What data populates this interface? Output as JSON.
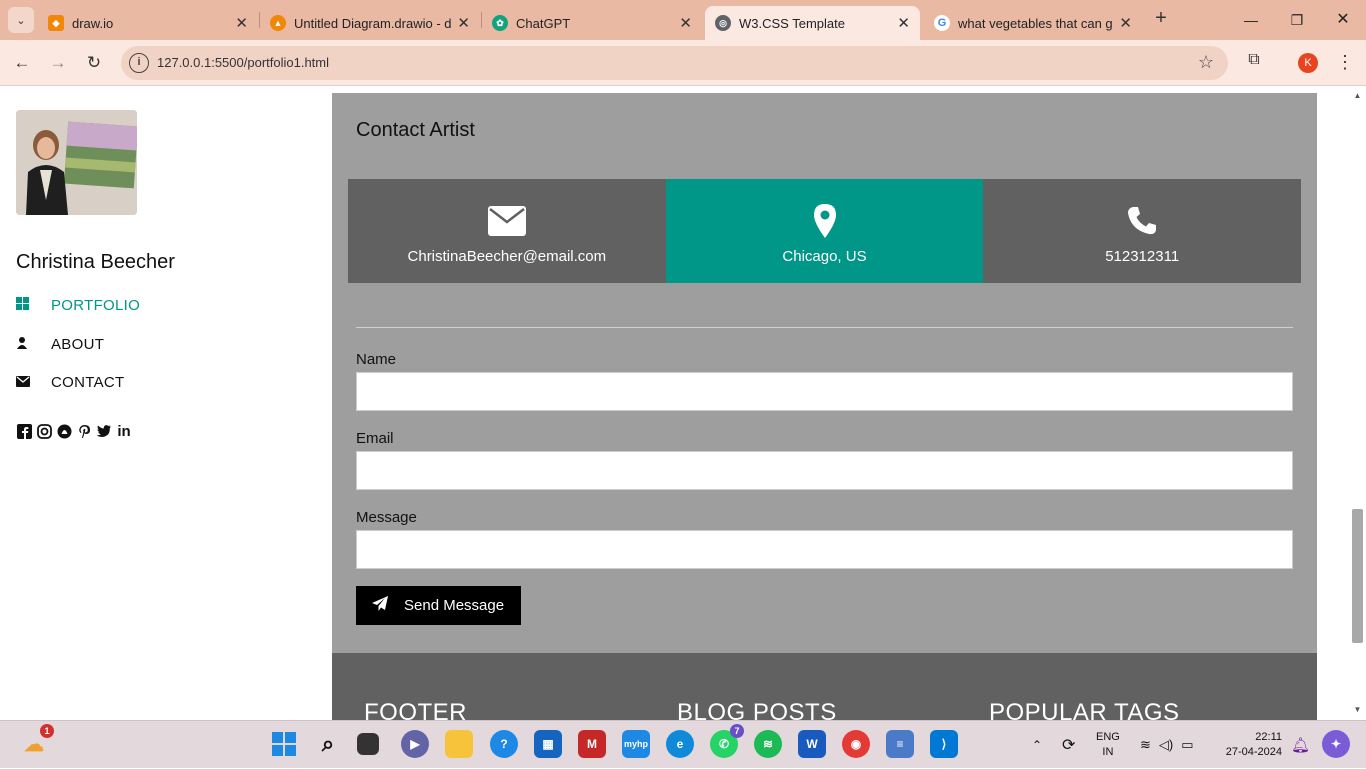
{
  "browser": {
    "tabs": [
      {
        "title": "draw.io",
        "favicon_color": "#f08705",
        "active": false
      },
      {
        "title": "Untitled Diagram.drawio - d",
        "favicon_color": "#f08705",
        "active": false
      },
      {
        "title": "ChatGPT",
        "favicon_color": "#10a37f",
        "active": false
      },
      {
        "title": "W3.CSS Template",
        "favicon_color": "#5f6368",
        "active": true
      },
      {
        "title": "what vegetables that can gr",
        "favicon_color": "#4285f4",
        "active": false
      }
    ],
    "url": "127.0.0.1:5500/portfolio1.html",
    "profile_initial": "K"
  },
  "sidebar": {
    "name": "Christina Beecher",
    "nav": [
      {
        "label": "PORTFOLIO",
        "icon": "th-large-icon",
        "active": true
      },
      {
        "label": "ABOUT",
        "icon": "user-icon",
        "active": false
      },
      {
        "label": "CONTACT",
        "icon": "envelope-icon",
        "active": false
      }
    ],
    "social": [
      "facebook-icon",
      "instagram-icon",
      "snapchat-icon",
      "pinterest-icon",
      "twitter-icon",
      "linkedin-icon"
    ]
  },
  "contact": {
    "title": "Contact Artist",
    "info": [
      {
        "icon": "envelope-icon",
        "text": "ChristinaBeecher@email.com",
        "color": "#616161"
      },
      {
        "icon": "map-marker-icon",
        "text": "Chicago, US",
        "color": "#009688"
      },
      {
        "icon": "phone-icon",
        "text": "512312311",
        "color": "#616161"
      }
    ],
    "fields": {
      "name_label": "Name",
      "email_label": "Email",
      "message_label": "Message"
    },
    "send_label": "Send Message"
  },
  "footer": {
    "col1": "FOOTER",
    "col2": "BLOG POSTS",
    "col3": "POPULAR TAGS"
  },
  "taskbar": {
    "weather_badge": "1",
    "whatsapp_badge": "7",
    "lang_top": "ENG",
    "lang_bottom": "IN",
    "time": "22:11",
    "date": "27-04-2024"
  },
  "colors": {
    "accent": "#009688",
    "section_bg": "#9e9e9e",
    "dark": "#616161"
  }
}
